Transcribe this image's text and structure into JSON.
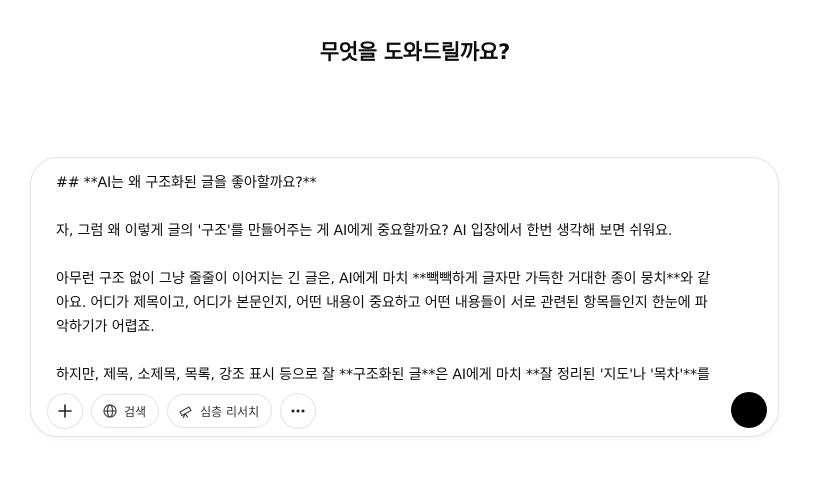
{
  "header": {
    "title": "무엇을 도와드릴까요?"
  },
  "composer": {
    "lines": [
      "## **AI는 왜 구조화된 글을 좋아할까요?**",
      "",
      "자, 그럼 왜 이렇게 글의 '구조'를 만들어주는 게 AI에게 중요할까요? AI 입장에서 한번 생각해 보면 쉬워요.",
      "",
      "아무런 구조 없이 그냥 줄줄이 이어지는 긴 글은, AI에게 마치 **빽빽하게 글자만 가득한 거대한 종이 뭉치**와 같",
      "아요. 어디가 제목이고, 어디가 본문인지, 어떤 내용이 중요하고 어떤 내용들이 서로 관련된 항목들인지 한눈에 파",
      "악하기가 어렵죠.",
      "",
      "하지만, 제목, 소제목, 목록, 강조 표시 등으로 잘 **구조화된 글**은 AI에게 마치 **잘 정리된 '지도'나 '목차'**를"
    ]
  },
  "toolbar": {
    "add_icon": "plus-icon",
    "search_icon": "globe-icon",
    "search_label": "검색",
    "research_icon": "telescope-icon",
    "research_label": "심층 리서치",
    "more_icon": "more-horizontal-icon"
  },
  "send": {
    "icon": "send-icon"
  }
}
